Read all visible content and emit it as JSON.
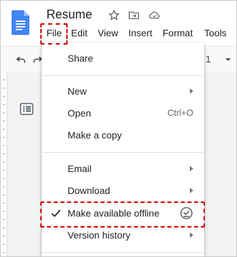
{
  "doc": {
    "title": "Resume"
  },
  "menubar": {
    "file": "File",
    "edit": "Edit",
    "view": "View",
    "insert": "Insert",
    "format": "Format",
    "tools": "Tools"
  },
  "toolbar": {
    "partial_text": "1"
  },
  "file_menu": {
    "share": "Share",
    "new": "New",
    "open": "Open",
    "open_shortcut": "Ctrl+O",
    "make_copy": "Make a copy",
    "email": "Email",
    "download": "Download",
    "offline": "Make available offline",
    "version_history": "Version history"
  },
  "colors": {
    "highlight": "#d30000",
    "docs_blue": "#4285f4"
  }
}
